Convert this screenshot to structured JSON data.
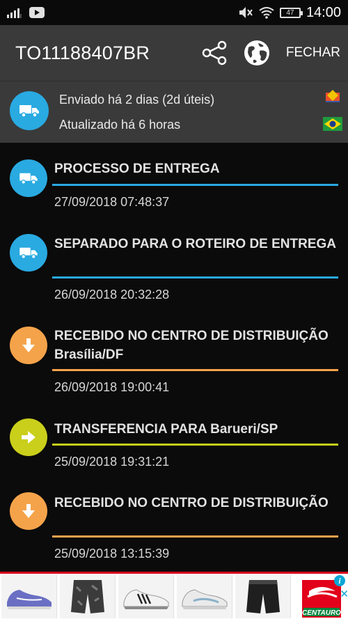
{
  "status_bar": {
    "time": "14:00",
    "battery": "47"
  },
  "header": {
    "tracking_code": "TO11188407BR",
    "close_label": "FECHAR"
  },
  "info": {
    "sent": "Enviado há 2 dias (2d úteis)",
    "updated": "Atualizado há 6 horas"
  },
  "events": [
    {
      "title": "PROCESSO DE ENTREGA",
      "date": "27/09/2018 07:48:37",
      "icon": "truck-icon",
      "color": "#29aae1"
    },
    {
      "title": "SEPARADO PARA O ROTEIRO DE ENTREGA",
      "date": "26/09/2018 20:32:28",
      "icon": "truck-icon",
      "color": "#29aae1"
    },
    {
      "title": "RECEBIDO NO CENTRO DE DISTRIBUIÇÃO Brasília/DF",
      "date": "26/09/2018 19:00:41",
      "icon": "arrow-down-icon",
      "color": "#f5a34a"
    },
    {
      "title": "TRANSFERENCIA PARA Barueri/SP",
      "date": "25/09/2018 19:31:21",
      "icon": "arrow-right-icon",
      "color": "#c9cf1a"
    },
    {
      "title": "RECEBIDO NO CENTRO DE DISTRIBUIÇÃO",
      "date": "25/09/2018 13:15:39",
      "icon": "arrow-down-icon",
      "color": "#f5a34a"
    }
  ],
  "ad": {
    "brand_logo": "CENTAURO"
  }
}
